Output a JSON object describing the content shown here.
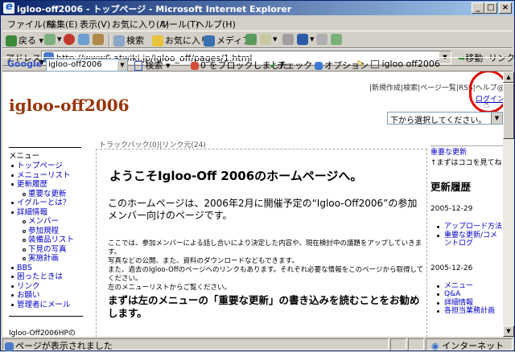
{
  "window": {
    "title": "igloo-off2006 - トップページ - Microsoft Internet Explorer",
    "controls": [
      "_",
      "□",
      "×"
    ]
  },
  "menu": [
    "ファイル(F)",
    "編集(E)",
    "表示(V)",
    "お気に入り(A)",
    "ツール(T)",
    "ヘルプ(H)"
  ],
  "toolbar": {
    "back": "戻る",
    "search": "検索",
    "favorites": "お気に入り",
    "media": "メディア"
  },
  "address": {
    "label": "アドレス(D)",
    "url": "http://www6.atwiki.jp/igloo_off/pages/1.html",
    "go": "移動",
    "links": "リンク"
  },
  "google_bar": {
    "logo": "Google",
    "query": "igloo-off2006",
    "search": "検索",
    "popup": "0 をブロックしました",
    "check": "チェック",
    "options": "オプション",
    "site": "igloo off2006"
  },
  "page": {
    "top_links": "|新規作成|検索|ページ一覧|RSS|ヘルプ@Wiki",
    "login": "ログイン",
    "site_title": "igloo-off2006",
    "page_select": "下から選択してください。",
    "trackback": "トラックバック(0)|リンク元(24)"
  },
  "left_nav": {
    "header": "メニュー",
    "items": [
      {
        "label": "トップページ",
        "sub": false
      },
      {
        "label": "メニューリスト",
        "sub": false
      },
      {
        "label": "更新履歴",
        "sub": false
      },
      {
        "label": "重要な更新",
        "sub": true
      },
      {
        "label": "イグルーとは？",
        "sub": false
      },
      {
        "label": "詳細情報",
        "sub": false
      },
      {
        "label": "メンバー",
        "sub": true
      },
      {
        "label": "参加規程",
        "sub": true
      },
      {
        "label": "装備品リスト",
        "sub": true
      },
      {
        "label": "下見の写真",
        "sub": true
      },
      {
        "label": "実施計画",
        "sub": true
      },
      {
        "label": "BBS",
        "sub": false
      },
      {
        "label": "困ったときは",
        "sub": false
      },
      {
        "label": "リンク",
        "sub": false
      },
      {
        "label": "お願い",
        "sub": false
      },
      {
        "label": "管理者にメール",
        "sub": false
      }
    ],
    "footer": "Igloo-Off2006HPの"
  },
  "main": {
    "heading": "ようこそIgloo-Off 2006のホームページへ。",
    "intro": "このホームページは、2006年2月に開催予定の“Igloo-Off2006”の参加メンバー向けのページです。",
    "small_lines": [
      "ここでは、参加メンバーによる話し合いにより決定した内容や、現在検討中の議題をアップしていきます。",
      "写真などの公開、また、資料のダウンロードなどもできます。",
      "また、過去のIgloo-Offのページへのリンクもあります。それぞれ必要な情報をこのページから取得してください。",
      "左のメニューリストからご覧ください。"
    ],
    "subheading": "まずは左のメニューの「重要な更新」の書き込みを読むことをお勧めします。"
  },
  "right_sidebar": {
    "important_label": "重要な更新",
    "important_link": "↑まずはココを見てね",
    "history_title": "更新履歴",
    "entries": [
      {
        "date": "2005-12-29",
        "items": [
          "アップロード方法",
          "重要な更新/コメントログ"
        ]
      },
      {
        "date": "2005-12-26",
        "items": [
          "メニュー",
          "Q&A",
          "詳細情報",
          "各担当業務計画"
        ]
      }
    ]
  },
  "status": {
    "text": "ページが表示されました",
    "zone": "インターネット"
  },
  "colors": {
    "title_bar": "#0a246a",
    "site_title": "#993300",
    "highlight_circle": "#e00000",
    "link": "#0000cc"
  }
}
